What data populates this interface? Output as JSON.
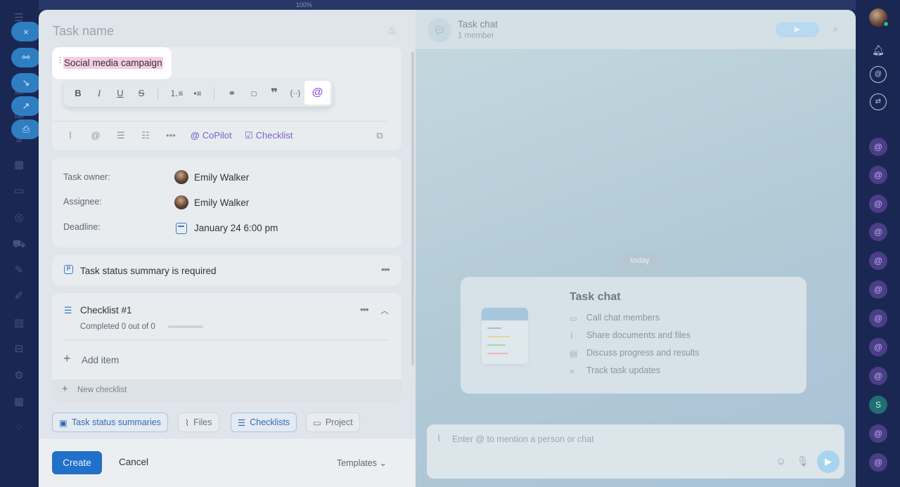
{
  "top_strip": {
    "zoom": "100%"
  },
  "left_sidebar": {
    "floating_buttons": [
      "×",
      "🔗",
      "↘",
      "↗",
      "⎙"
    ],
    "icons": [
      "menu-icon",
      "home-icon",
      "chat-icon",
      "calendar-icon",
      "drive-icon",
      "target-icon",
      "cart-icon",
      "edit-icon",
      "pen-icon",
      "chart-icon",
      "table-icon",
      "gear-icon",
      "grid-icon"
    ]
  },
  "task": {
    "name_placeholder": "Task name",
    "title": "Social media campaign",
    "editor_links": {
      "copilot": "CoPilot",
      "checklist": "Checklist"
    },
    "owner_label": "Task owner:",
    "owner": "Emily Walker",
    "assignee_label": "Assignee:",
    "assignee": "Emily Walker",
    "deadline_label": "Deadline:",
    "deadline": "January 24 6:00 pm",
    "status_summary": "Task status summary is required",
    "checklist": {
      "title": "Checklist #1",
      "progress": "Completed 0 out of 0",
      "progress_fraction": 0,
      "add_item": "Add item",
      "new_checklist": "New checklist"
    },
    "chips": {
      "status_summaries": "Task status summaries",
      "files": "Files",
      "checklists": "Checklists",
      "project": "Project"
    },
    "footer": {
      "create": "Create",
      "cancel": "Cancel",
      "templates": "Templates"
    }
  },
  "chat": {
    "title": "Task chat",
    "members": "1 member",
    "today": "today",
    "intro_title": "Task chat",
    "intro_items": [
      "Call chat members",
      "Share documents and files",
      "Discuss progress and results",
      "Track task updates"
    ],
    "composer_placeholder": "Enter @ to mention a person or chat"
  },
  "right_sidebar": {
    "bot_letter": "S"
  },
  "colors": {
    "accent": "#2170c9",
    "copilot": "#8f5ae6",
    "highlight": "#f6cde1"
  }
}
